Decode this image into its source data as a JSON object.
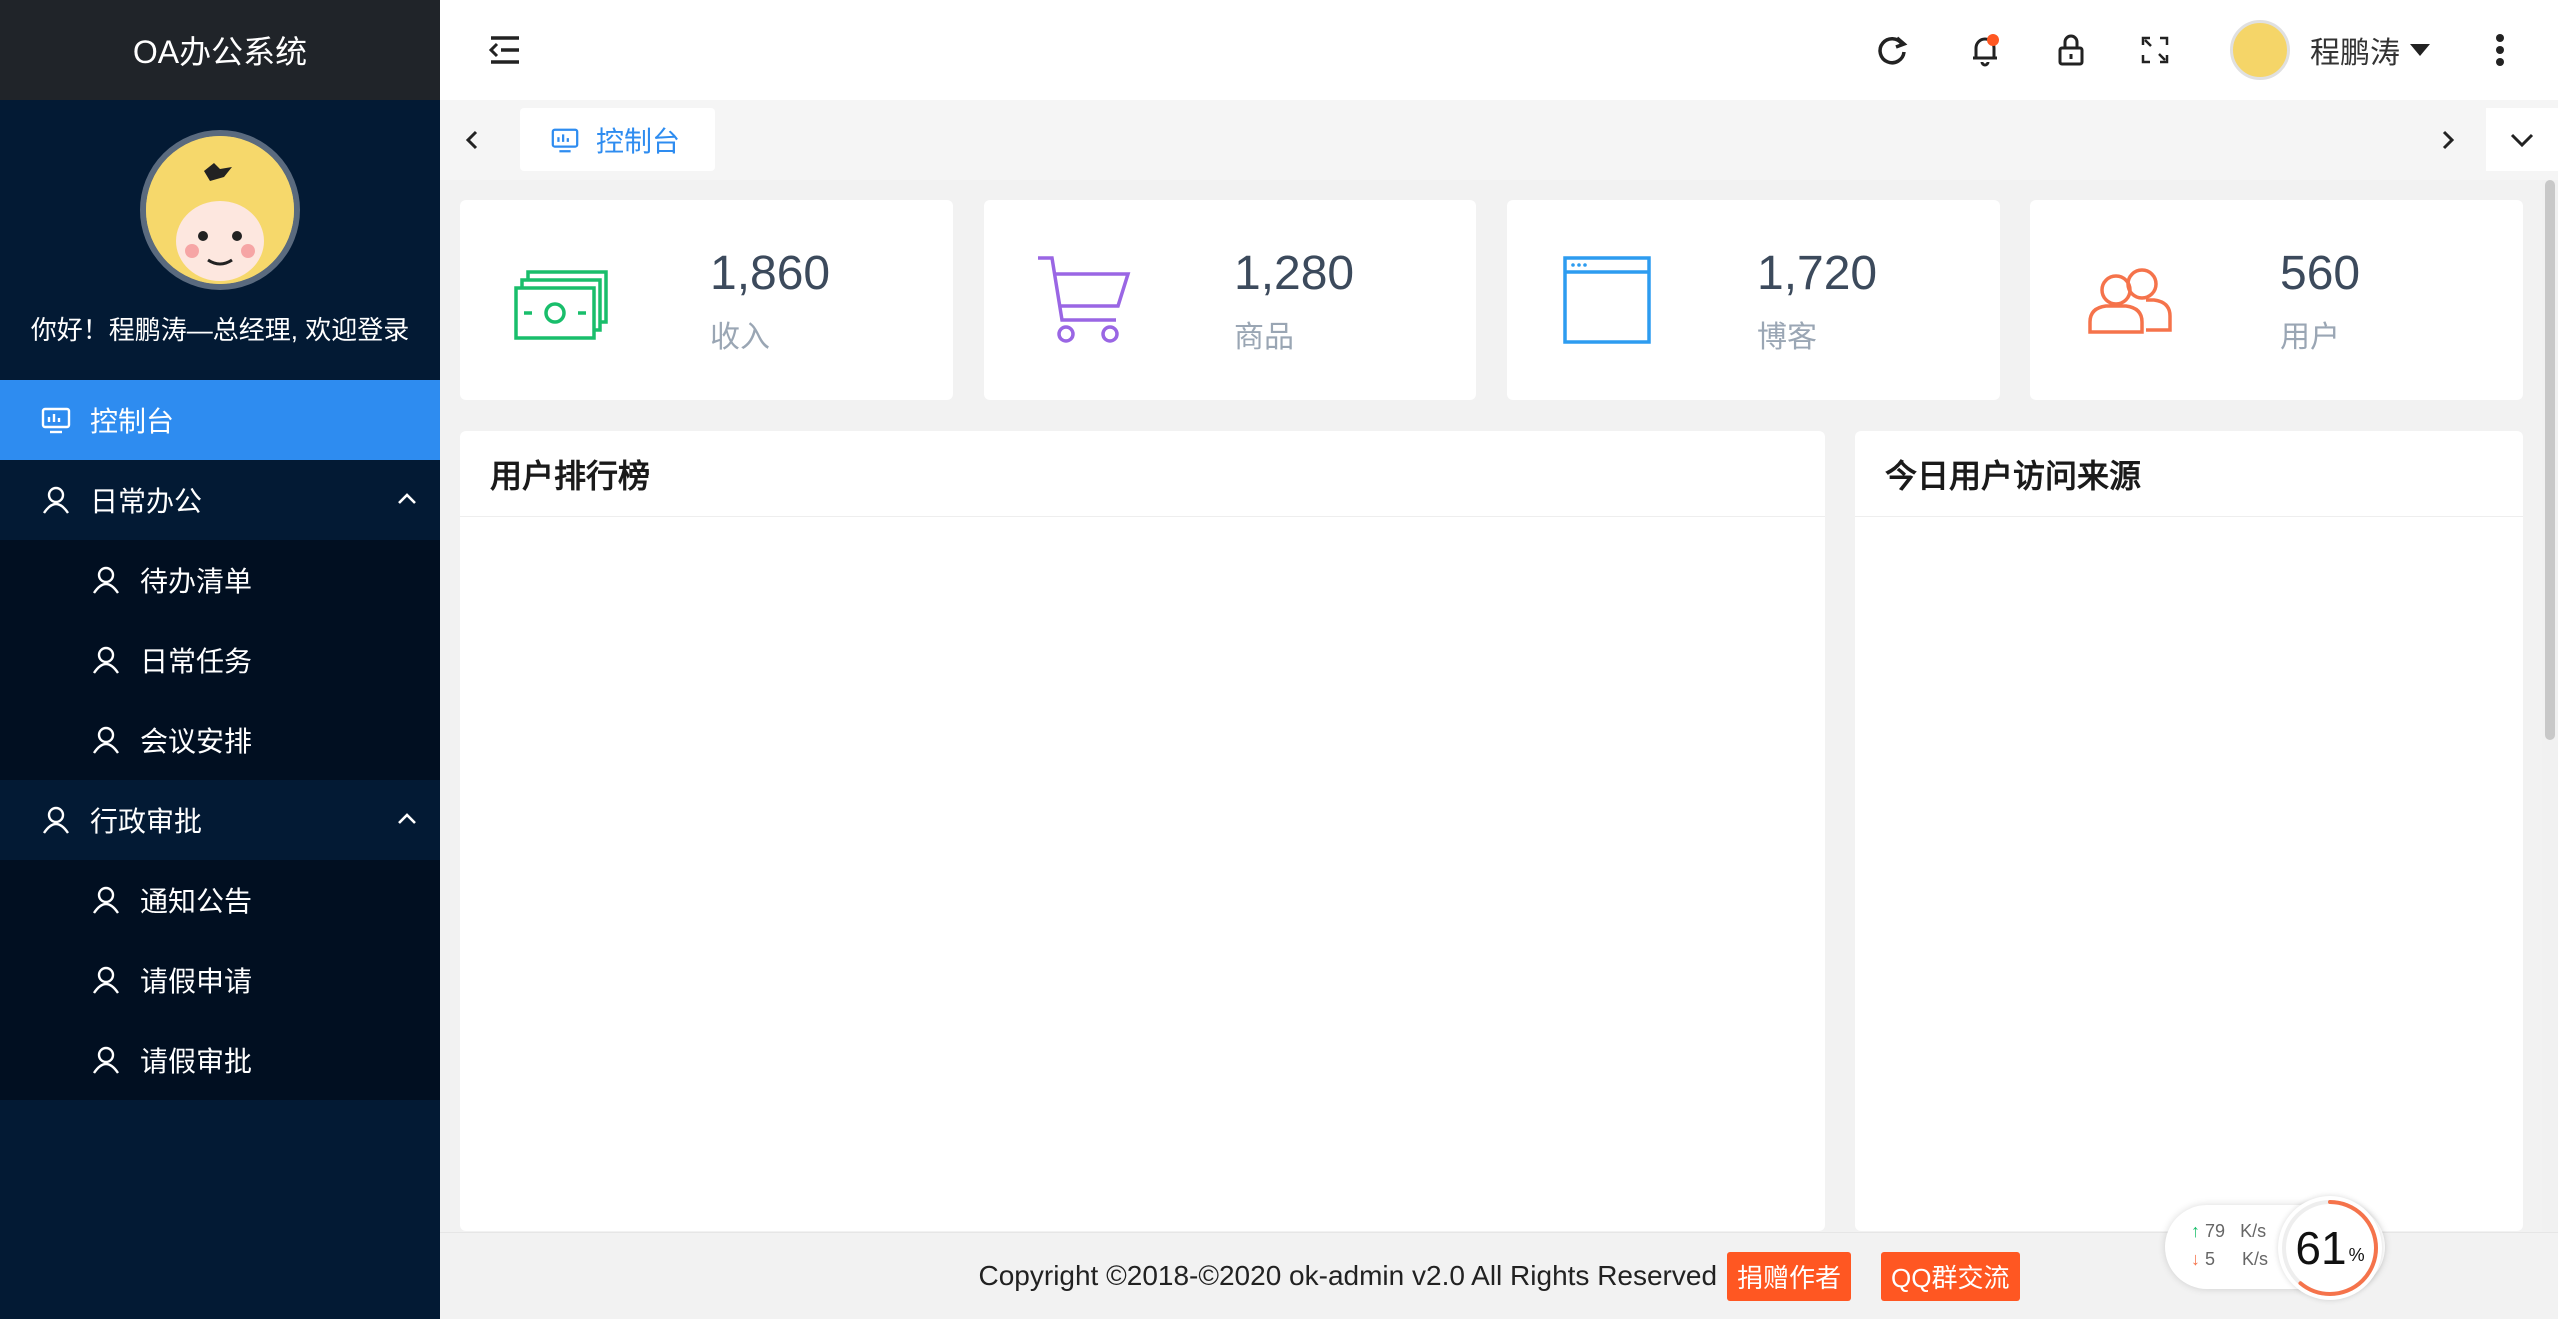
{
  "app": {
    "title": "OA办公系统"
  },
  "sidebar": {
    "greeting": "你好！程鹏涛—总经理, 欢迎登录",
    "items": [
      {
        "label": "控制台",
        "icon": "monitor-icon",
        "active": true
      },
      {
        "label": "日常办公",
        "icon": "user-icon",
        "expanded": true,
        "children": [
          {
            "label": "待办清单"
          },
          {
            "label": "日常任务"
          },
          {
            "label": "会议安排"
          }
        ]
      },
      {
        "label": "行政审批",
        "icon": "user-icon",
        "expanded": true,
        "children": [
          {
            "label": "通知公告"
          },
          {
            "label": "请假申请"
          },
          {
            "label": "请假审批"
          }
        ]
      }
    ]
  },
  "header": {
    "user_name": "程鹏涛"
  },
  "tabs": {
    "active_label": "控制台"
  },
  "stats": [
    {
      "value": "1,860",
      "label": "收入",
      "icon": "money-icon",
      "color": "#19be6b"
    },
    {
      "value": "1,280",
      "label": "商品",
      "icon": "cart-icon",
      "color": "#9a66e4"
    },
    {
      "value": "1,720",
      "label": "博客",
      "icon": "browser-window-icon",
      "color": "#2d9cf0"
    },
    {
      "value": "560",
      "label": "用户",
      "icon": "users-icon",
      "color": "#f5734b"
    }
  ],
  "panels": {
    "ranking_title": "用户排行榜",
    "sources_title": "今日用户访问来源"
  },
  "footer": {
    "copyright": "Copyright ©2018-©2020 ok-admin v2.0 All Rights Reserved",
    "donate_label": "捐赠作者",
    "qq_label": "QQ群交流"
  },
  "speed": {
    "up": "79",
    "down": "5",
    "unit": "K/s",
    "percent": "61",
    "percent_sign": "%",
    "percent_value": 0.61
  },
  "colors": {
    "accent": "#2e8cf0",
    "sidebar_bg": "#031a34",
    "badge": "#ff5722"
  }
}
